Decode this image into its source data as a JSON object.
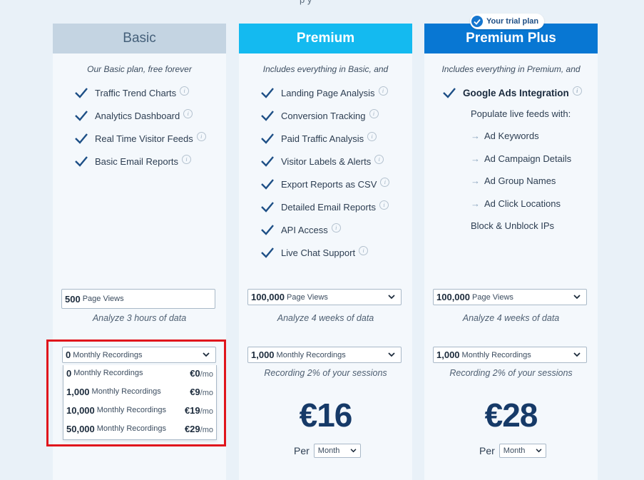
{
  "top_fragment": "p          y",
  "badge": {
    "label": "Your trial plan"
  },
  "plans": {
    "basic": {
      "name": "Basic",
      "intro": "Our Basic plan, free forever",
      "features": [
        "Traffic Trend Charts",
        "Analytics Dashboard",
        "Real Time Visitor Feeds",
        "Basic Email Reports"
      ],
      "pageviews_value": "500",
      "pageviews_unit": "Page Views",
      "pageviews_hint": "Analyze 3 hours of data",
      "recordings_value": "0",
      "recordings_unit": "Monthly Recordings",
      "dropdown_options": [
        {
          "value": "0",
          "unit": "Monthly Recordings",
          "price": "€0",
          "per": "/mo"
        },
        {
          "value": "1,000",
          "unit": "Monthly Recordings",
          "price": "€9",
          "per": "/mo"
        },
        {
          "value": "10,000",
          "unit": "Monthly Recordings",
          "price": "€19",
          "per": "/mo"
        },
        {
          "value": "50,000",
          "unit": "Monthly Recordings",
          "price": "€29",
          "per": "/mo"
        }
      ]
    },
    "premium": {
      "name": "Premium",
      "intro": "Includes everything in Basic, and",
      "features": [
        "Landing Page Analysis",
        "Conversion Tracking",
        "Paid Traffic Analysis",
        "Visitor Labels & Alerts",
        "Export Reports as CSV",
        "Detailed Email Reports",
        "API Access",
        "Live Chat Support"
      ],
      "pageviews_value": "100,000",
      "pageviews_unit": "Page Views",
      "pageviews_hint": "Analyze 4 weeks of data",
      "recordings_value": "1,000",
      "recordings_unit": "Monthly Recordings",
      "recordings_hint": "Recording 2% of your sessions",
      "price": "€16",
      "per_label": "Per",
      "period": "Month"
    },
    "plus": {
      "name": "Premium Plus",
      "intro": "Includes everything in Premium, and",
      "feature_main": "Google Ads Integration",
      "populate_label": "Populate live feeds with:",
      "feeds": [
        "Ad Keywords",
        "Ad Campaign Details",
        "Ad Group Names",
        "Ad Click Locations"
      ],
      "block_label": "Block & Unblock IPs",
      "pageviews_value": "100,000",
      "pageviews_unit": "Page Views",
      "pageviews_hint": "Analyze 4 weeks of data",
      "recordings_value": "1,000",
      "recordings_unit": "Monthly Recordings",
      "recordings_hint": "Recording 2% of your sessions",
      "price": "€28",
      "per_label": "Per",
      "period": "Month"
    }
  },
  "colors": {
    "background": "#e9f1f8",
    "basic_header": "#c4d4e2",
    "premium_header": "#14baf0",
    "plus_header": "#0877d3",
    "highlight": "#e0151c",
    "price": "#163a68"
  }
}
